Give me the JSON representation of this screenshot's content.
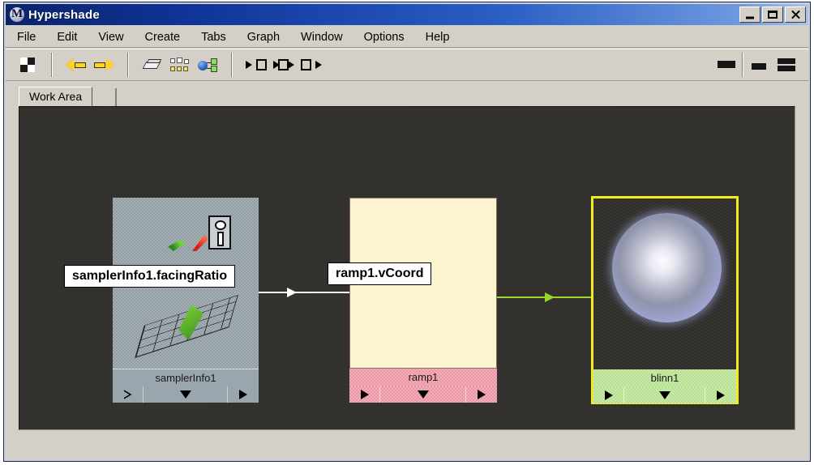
{
  "window": {
    "title": "Hypershade",
    "icon": "maya-m-icon",
    "buttons": {
      "minimize": "minimize-button",
      "maximize": "maximize-button",
      "close": "close-button"
    }
  },
  "menubar": {
    "items": [
      "File",
      "Edit",
      "View",
      "Create",
      "Tabs",
      "Graph",
      "Window",
      "Options",
      "Help"
    ]
  },
  "toolbar": {
    "groups": [
      {
        "buttons": [
          {
            "icon": "checkerboard-icon",
            "label": "Show Swatches"
          }
        ]
      },
      {
        "buttons": [
          {
            "icon": "arrow-left-icon",
            "label": "Back"
          },
          {
            "icon": "arrow-right-icon",
            "label": "Forward"
          }
        ]
      },
      {
        "buttons": [
          {
            "icon": "eraser-icon",
            "label": "Clear Graph"
          },
          {
            "icon": "rearrange-graph-icon",
            "label": "Rearrange Graph"
          },
          {
            "icon": "network-icon",
            "label": "Show Network"
          }
        ]
      },
      {
        "buttons": [
          {
            "icon": "input-connections-icon",
            "label": "Input Connections"
          },
          {
            "icon": "input-output-connections-icon",
            "label": "Input and Output Connections"
          },
          {
            "icon": "output-connections-icon",
            "label": "Output Connections"
          }
        ]
      },
      {
        "buttons": [
          {
            "icon": "single-panel-icon",
            "label": "Single Panel Layout"
          },
          {
            "icon": "two-panel-icon",
            "label": "Two Panel Layout"
          },
          {
            "icon": "split-panel-icon",
            "label": "Split Panel Layout"
          }
        ]
      }
    ]
  },
  "tabs": {
    "items": [
      {
        "label": "Work Area",
        "active": true
      }
    ]
  },
  "workarea": {
    "background_color": "#302f2b",
    "nodes": [
      {
        "id": "samplerInfo1",
        "name": "samplerInfo1",
        "swatch_color": "#9aa6ad",
        "bar_color": "#9aa6ad",
        "selected": false,
        "left_button": "expand-input-arrow",
        "center_button": "node-menu-arrow",
        "right_button": "expand-output-arrow"
      },
      {
        "id": "ramp1",
        "name": "ramp1",
        "swatch_color": "#fbf4cf",
        "bar_color": "#f3a0ad",
        "selected": false,
        "left_button": "expand-input-arrow",
        "center_button": "node-menu-arrow",
        "right_button": "expand-output-arrow"
      },
      {
        "id": "blinn1",
        "name": "blinn1",
        "swatch_color": "#302f2b",
        "bar_color": "#bfe89a",
        "selected": true,
        "selection_color": "#f2ec1c",
        "left_button": "expand-input-arrow",
        "center_button": "node-menu-arrow",
        "right_button": "expand-output-arrow"
      }
    ],
    "connections": [
      {
        "id": "conn-sampler-ramp",
        "from": "samplerInfo1",
        "to": "ramp1",
        "color": "#ffffff"
      },
      {
        "id": "conn-ramp-blinn",
        "from": "ramp1",
        "to": "blinn1",
        "color": "#9ad62f"
      }
    ],
    "tooltips": [
      {
        "id": "tooltip-source",
        "text": "samplerInfo1.facingRatio"
      },
      {
        "id": "tooltip-destination",
        "text": "ramp1.vCoord"
      }
    ]
  }
}
